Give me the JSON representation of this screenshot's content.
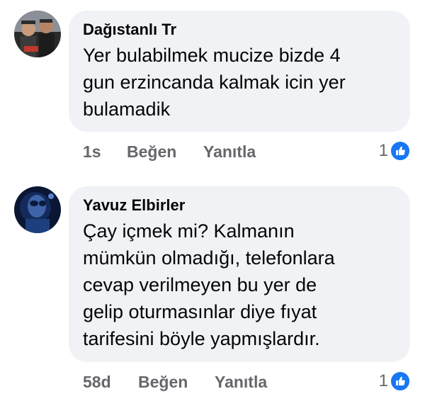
{
  "comments": [
    {
      "author": "Dağıstanlı Tr",
      "lines": [
        "Yer bulabilmek mucize bizde 4",
        "gun erzincanda kalmak icin yer",
        "bulamadik"
      ],
      "time": "1s",
      "like_label": "Beğen",
      "reply_label": "Yanıtla",
      "reaction_count": "1",
      "reaction_icon": "thumbs-up-icon"
    },
    {
      "author": "Yavuz Elbirler",
      "lines": [
        "Çay içmek mi? Kalmanın",
        "mümkün olmadığı, telefonlara",
        "cevap verilmeyen bu yer de",
        "gelip oturmasınlar diye fıyat",
        "tarifesini böyle yapmışlardır."
      ],
      "time": "58d",
      "like_label": "Beğen",
      "reply_label": "Yanıtla",
      "reaction_count": "1",
      "reaction_icon": "thumbs-up-icon"
    }
  ],
  "colors": {
    "bubble": "#f0f2f5",
    "meta_text": "#65676b",
    "like_blue": "#1877f2"
  }
}
